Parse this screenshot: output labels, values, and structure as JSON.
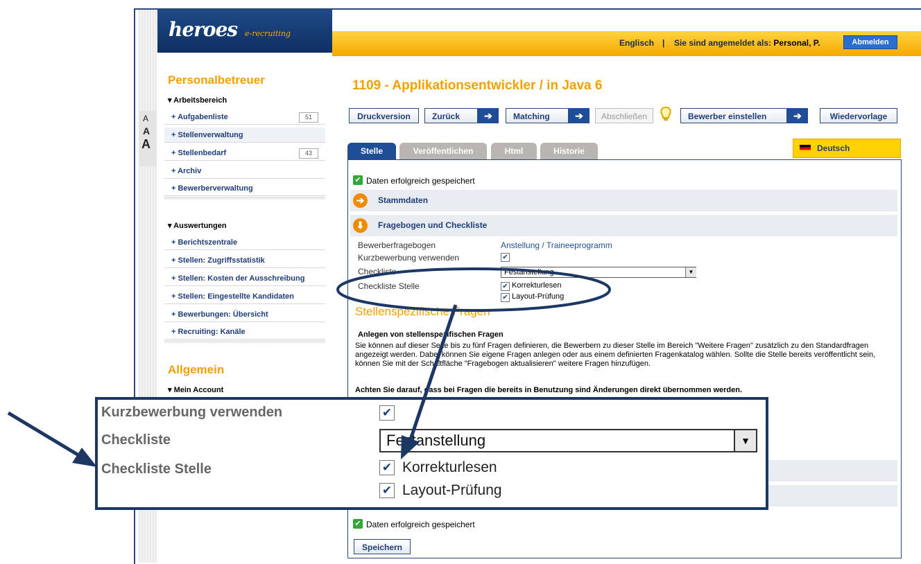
{
  "header": {
    "logo": "heroes",
    "logo_sub": "e-recruiting",
    "language_link": "Englisch",
    "separator": "|",
    "login_prefix": "Sie sind angemeldet als: ",
    "user_name": "Personal, P.",
    "logout": "Abmelden"
  },
  "font_size_labels": [
    "A",
    "A",
    "A"
  ],
  "sidebar": {
    "section1_title": "Personalbetreuer",
    "section1_sub": "▾ Arbeitsbereich",
    "section1_items": [
      {
        "label": "+ Aufgabenliste",
        "count": "51"
      },
      {
        "label": "+ Stellenverwaltung",
        "count": ""
      },
      {
        "label": "+ Stellenbedarf",
        "count": "43"
      },
      {
        "label": "+ Archiv",
        "count": ""
      },
      {
        "label": "+ Bewerberverwaltung",
        "count": ""
      }
    ],
    "section2_sub": "▾ Auswertungen",
    "section2_items": [
      {
        "label": "+ Berichtszentrale"
      },
      {
        "label": "+ Stellen: Zugriffsstatistik"
      },
      {
        "label": "+ Stellen: Kosten der Ausschreibung"
      },
      {
        "label": "+ Stellen: Eingestellte Kandidaten"
      },
      {
        "label": "+ Bewerbungen: Übersicht"
      },
      {
        "label": "+ Recruiting: Kanäle"
      }
    ],
    "section3_title": "Allgemein",
    "section3_sub": "▾ Mein Account"
  },
  "main": {
    "title": "1109 - Applikationsentwickler / in Java 6",
    "buttons": {
      "print": "Druckversion",
      "back": "Zurück",
      "matching": "Matching",
      "close": "Abschließen",
      "applicant": "Bewerber einstellen",
      "resubmit": "Wiedervorlage"
    },
    "tabs": [
      "Stelle",
      "Veröffentlichen",
      "Html",
      "Historie"
    ],
    "language_tab": "Deutsch",
    "saved_msg": "Daten erfolgreich gespeichert",
    "section_stammdaten": "Stammdaten",
    "section_fragebogen": "Fragebogen und Checkliste",
    "form": {
      "questionnaire_label": "Bewerberfragebogen",
      "questionnaire_value": "Anstellung / Traineeprogramm",
      "short_app_label": "Kurzbewerbung verwenden",
      "checklist_label": "Checkliste",
      "checklist_value": "Festanstellung",
      "checklist_job_label": "Checkliste Stelle",
      "checklist_items": [
        "Korrekturlesen",
        "Layout-Prüfung"
      ]
    },
    "specific_questions": {
      "title": "Stellenspezifische Fragen",
      "subtitle": "Anlegen von stellenspezifischen Fragen",
      "text": "Sie können auf dieser Seite bis zu fünf Fragen definieren, die Bewerbern zu dieser Stelle im Bereich \"Weitere Fragen\" zusätzlich zu den Standardfragen angezeigt werden. Dabei können Sie eigene Fragen anlegen oder aus einem definierten Fragenkatalog wählen. Sollte die Stelle bereits veröffentlicht sein, können Sie mit der Schaltfläche \"Fragebogen aktualisieren\" weitere Fragen hinzufügen.",
      "warning": "Achten Sie darauf, dass bei Fragen die bereits in Benutzung sind Änderungen direkt übernommen werden."
    },
    "saved_msg_bottom": "Daten erfolgreich gespeichert",
    "save_button": "Speichern"
  },
  "zoom": {
    "short_app_label": "Kurzbewerbung verwenden",
    "checklist_label": "Checkliste",
    "checklist_value": "Festanstellung",
    "checklist_job_label": "Checkliste Stelle",
    "checklist_items": [
      "Korrekturlesen",
      "Layout-Prüfung"
    ]
  },
  "colors": {
    "accent_orange": "#f5a000",
    "navy": "#1f4e96",
    "annotation": "#1c3764"
  }
}
